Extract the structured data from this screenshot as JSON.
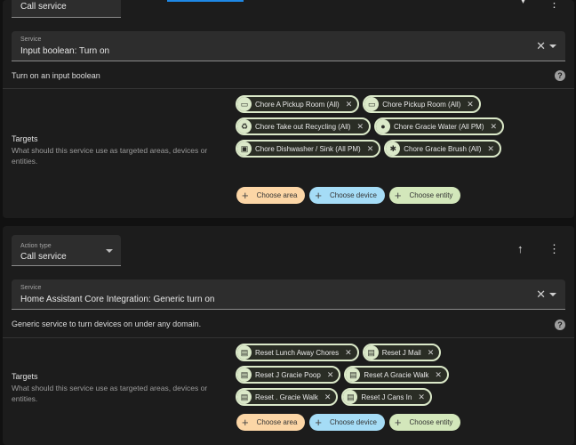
{
  "card1": {
    "action_type_value": "Call service",
    "service_label": "Service",
    "service_value": "Input boolean: Turn on",
    "clear_symbol": "✕",
    "description": "Turn on an input boolean",
    "help_symbol": "?",
    "targets_title": "Targets",
    "targets_desc": "What should this service use as targeted areas, devices or entities.",
    "chips": [
      [
        {
          "icon": "bed-icon",
          "label": "Chore A          Pickup Room (All)"
        },
        {
          "icon": "bed-icon",
          "label": "Chore              Pickup Room (All)"
        }
      ],
      [
        {
          "icon": "recycle-icon",
          "label": "Chore              Take out Recycling (All)"
        },
        {
          "icon": "water-drop-icon",
          "label": "Chore              Gracie Water (All PM)"
        }
      ],
      [
        {
          "icon": "dishwasher-icon",
          "label": "Chore              Dishwasher / Sink (All PM)"
        },
        {
          "icon": "paw-icon",
          "label": "Chore              Gracie Brush (All)"
        }
      ]
    ],
    "pickers": {
      "area": "Choose area",
      "device": "Choose device",
      "entity": "Choose entity"
    }
  },
  "card2": {
    "action_type_label": "Action type",
    "action_type_value": "Call service",
    "service_label": "Service",
    "service_value": "Home Assistant Core Integration: Generic turn on",
    "clear_symbol": "✕",
    "description": "Generic service to turn devices on under any domain.",
    "help_symbol": "?",
    "targets_title": "Targets",
    "targets_desc": "What should this service use as targeted areas, devices or entities.",
    "chips": [
      [
        {
          "icon": "script-icon",
          "label": "Reset Lunch Away Chores"
        },
        {
          "icon": "script-icon",
          "label": "Reset J           Mail"
        }
      ],
      [
        {
          "icon": "script-icon",
          "label": "Reset J           Gracie Poop"
        },
        {
          "icon": "script-icon",
          "label": "Reset A           Gracie Walk"
        }
      ],
      [
        {
          "icon": "script-icon",
          "label": "Reset .            Gracie Walk"
        },
        {
          "icon": "script-icon",
          "label": "Reset J           Cans In"
        }
      ]
    ],
    "pickers": {
      "area": "Choose area",
      "device": "Choose device",
      "entity": "Choose entity"
    }
  },
  "icons": {
    "up_arrow": "↑",
    "more": "⋮",
    "chip_close": "✕",
    "plus": "+"
  }
}
